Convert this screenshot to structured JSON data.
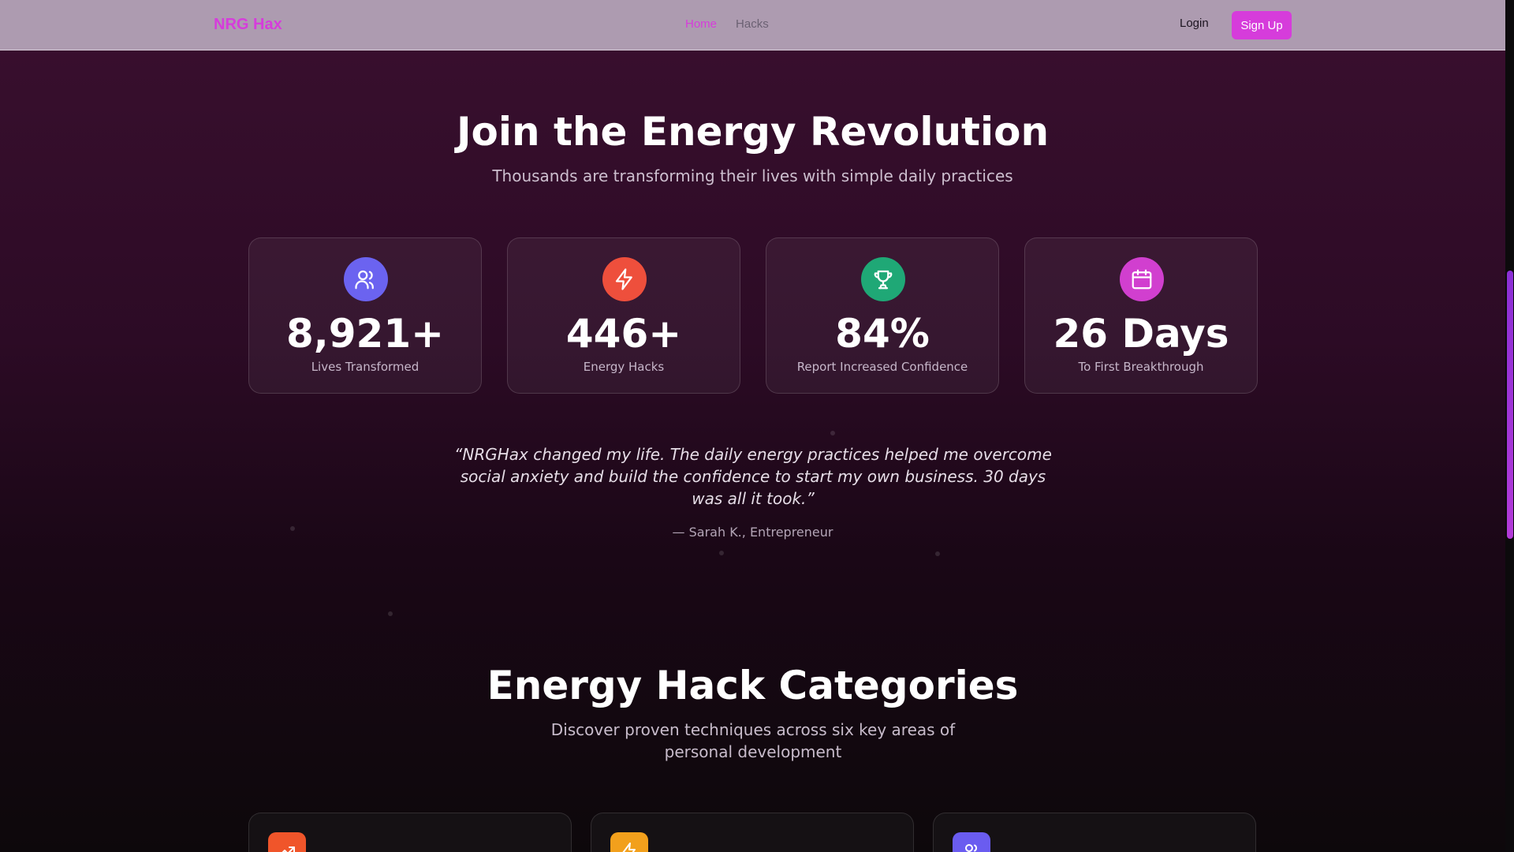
{
  "nav": {
    "brand": "NRG Hax",
    "links": [
      {
        "label": "Home",
        "active": true
      },
      {
        "label": "Hacks",
        "active": false
      }
    ],
    "login": "Login",
    "signup": "Sign Up"
  },
  "hero": {
    "title": "Join the Energy Revolution",
    "subtitle": "Thousands are transforming their lives with simple daily practices"
  },
  "stats": [
    {
      "icon": "users-icon",
      "value": "8,921+",
      "label": "Lives Transformed",
      "color": "#6b63f0"
    },
    {
      "icon": "lightning-icon",
      "value": "446+",
      "label": "Energy Hacks",
      "color": "#ee4f3c"
    },
    {
      "icon": "trophy-icon",
      "value": "84%",
      "label": "Report Increased Confidence",
      "color": "#1fa876"
    },
    {
      "icon": "calendar-icon",
      "value": "26 Days",
      "label": "To First Breakthrough",
      "color": "#d13fcf"
    }
  ],
  "testimonial": {
    "quote": "“NRGHax changed my life. The daily energy practices helped me overcome social anxiety and build the confidence to start my own business. 30 days was all it took.”",
    "author": "— Sarah K., Entrepreneur"
  },
  "categories": {
    "title": "Energy Hack Categories",
    "subtitle": "Discover proven techniques across six key areas of personal development",
    "cards": [
      {
        "icon": "trending-up-icon",
        "color": "#f0552a"
      },
      {
        "icon": "lightning-icon",
        "color": "#f2a01c"
      },
      {
        "icon": "users-icon",
        "color": "#6a5cf0"
      }
    ]
  }
}
